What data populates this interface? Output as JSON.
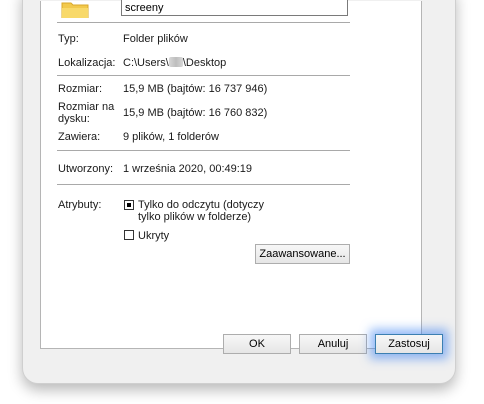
{
  "name_field": {
    "value": "screeny"
  },
  "properties": {
    "type": {
      "label": "Typ:",
      "value": "Folder plików"
    },
    "location": {
      "label": "Lokalizacja:",
      "value_prefix": "C:\\Users\\",
      "value_suffix": "\\Desktop"
    },
    "size": {
      "label": "Rozmiar:",
      "value": "15,9 MB (bajtów: 16 737 946)"
    },
    "size_on_disk": {
      "label_line1": "Rozmiar na",
      "label_line2": "dysku:",
      "value": "15,9 MB (bajtów: 16 760 832)"
    },
    "contains": {
      "label": "Zawiera:",
      "value": "9 plików, 1 folderów"
    },
    "created": {
      "label": "Utworzony:",
      "value": "1 września 2020, 00:49:19"
    }
  },
  "attributes": {
    "label": "Atrybuty:",
    "readonly_line1": "Tylko do odczytu (dotyczy",
    "readonly_line2": "tylko plików w folderze)",
    "hidden": "Ukryty",
    "advanced_button": "Zaawansowane..."
  },
  "footer": {
    "ok": "OK",
    "cancel": "Anuluj",
    "apply": "Zastosuj"
  },
  "colors": {
    "folder": "#f2c94c",
    "apply_glow": "#3c82f0",
    "dialog_bg": "#f0f0f0"
  }
}
